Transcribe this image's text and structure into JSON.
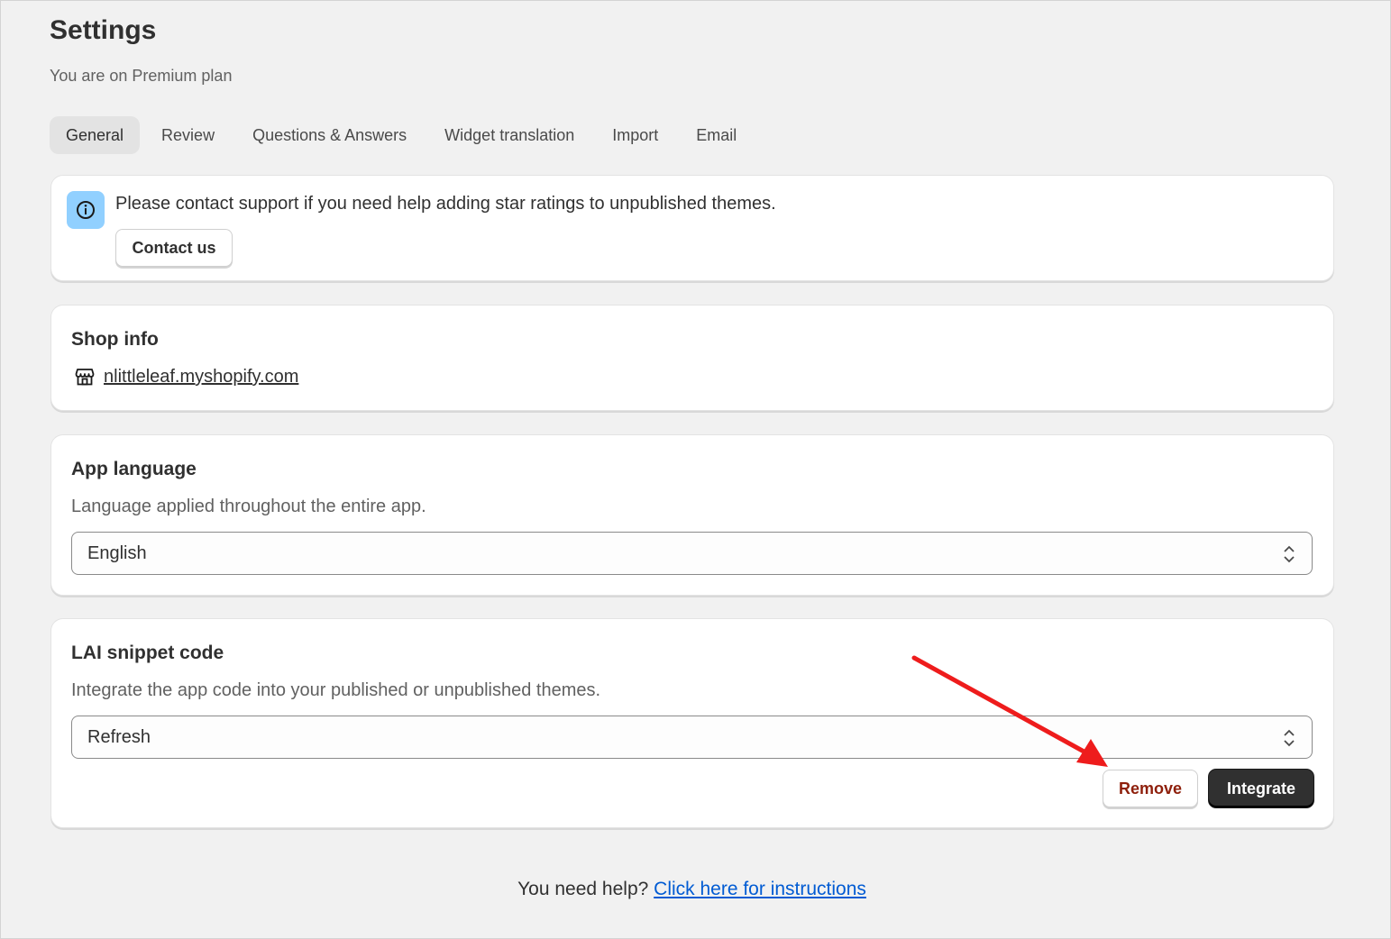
{
  "header": {
    "title": "Settings",
    "subtitle": "You are on Premium plan"
  },
  "tabs": [
    {
      "label": "General",
      "active": true
    },
    {
      "label": "Review",
      "active": false
    },
    {
      "label": "Questions & Answers",
      "active": false
    },
    {
      "label": "Widget translation",
      "active": false
    },
    {
      "label": "Import",
      "active": false
    },
    {
      "label": "Email",
      "active": false
    }
  ],
  "banner": {
    "icon": "info-icon",
    "text": "Please contact support if you need help adding star ratings to unpublished themes.",
    "button_label": "Contact us",
    "icon_bg": "#91d0ff"
  },
  "shop_info": {
    "title": "Shop info",
    "icon": "store-icon",
    "domain": "nlittleleaf.myshopify.com"
  },
  "app_language": {
    "title": "App language",
    "description": "Language applied throughout the entire app.",
    "selected": "English"
  },
  "snippet": {
    "title": "LAI snippet code",
    "description": "Integrate the app code into your published or unpublished themes.",
    "selected": "Refresh",
    "remove_label": "Remove",
    "integrate_label": "Integrate",
    "remove_color": "#8e1f0b"
  },
  "footer": {
    "help_text": "You need help?",
    "link_text": "Click here for instructions",
    "link_color": "#005bd3"
  },
  "annotation": {
    "arrow_color": "#ee1c1c"
  }
}
